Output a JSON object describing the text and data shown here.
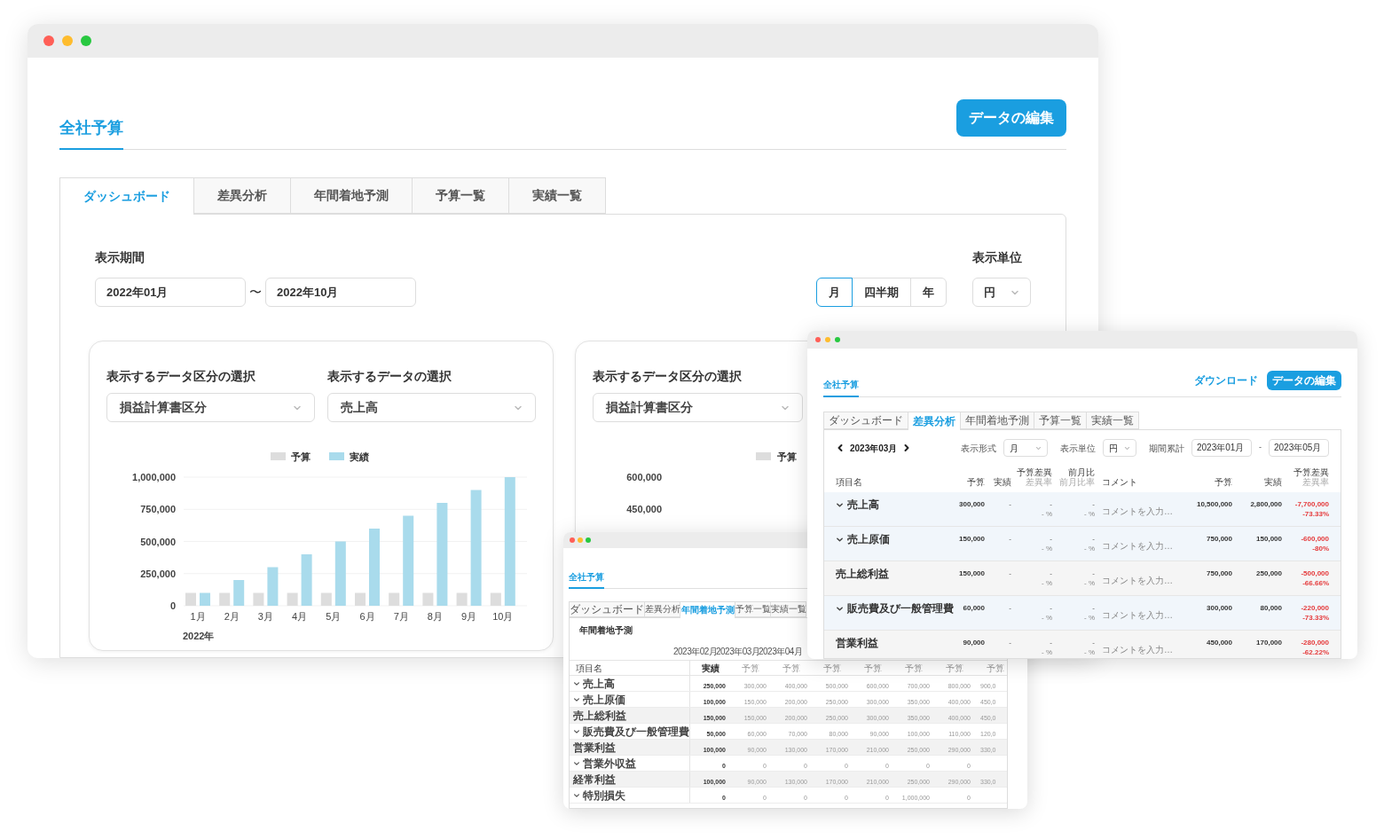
{
  "main_window": {
    "title": "全社予算",
    "edit_button": "データの編集",
    "tabs": [
      {
        "label": "ダッシュボード",
        "selected": true
      },
      {
        "label": "差異分析",
        "selected": false
      },
      {
        "label": "年間着地予測",
        "selected": false
      },
      {
        "label": "予算一覧",
        "selected": false
      },
      {
        "label": "実績一覧",
        "selected": false
      }
    ],
    "period": {
      "label": "表示期間",
      "from": "2022年01月",
      "separator": "〜",
      "to": "2022年10月"
    },
    "granularity": [
      {
        "label": "月",
        "selected": true
      },
      {
        "label": "四半期",
        "selected": false
      },
      {
        "label": "年",
        "selected": false
      }
    ],
    "unit": {
      "label": "表示単位",
      "value": "円"
    },
    "panels": [
      {
        "category_label": "表示するデータ区分の選択",
        "category_value": "損益計算書区分",
        "data_label": "表示するデータの選択",
        "data_value": "売上高",
        "chart_data": {
          "type": "bar",
          "xlabel": "2022年",
          "categories": [
            "1月",
            "2月",
            "3月",
            "4月",
            "5月",
            "6月",
            "7月",
            "8月",
            "9月",
            "10月"
          ],
          "series": [
            {
              "name": "予算",
              "color": "#dddddd",
              "values": [
                100000,
                100000,
                100000,
                100000,
                100000,
                100000,
                100000,
                100000,
                100000,
                100000
              ]
            },
            {
              "name": "実績",
              "color": "#a9dbec",
              "values": [
                100000,
                200000,
                300000,
                400000,
                500000,
                600000,
                700000,
                800000,
                900000,
                1000000
              ]
            }
          ],
          "ylim": [
            0,
            1000000
          ],
          "grid": true,
          "legend": true,
          "yticks": [
            {
              "value": 0,
              "label": "0"
            },
            {
              "value": 250000,
              "label": "250,000"
            },
            {
              "value": 500000,
              "label": "500,000"
            },
            {
              "value": 750000,
              "label": "750,000"
            },
            {
              "value": 1000000,
              "label": "1,000,000"
            }
          ]
        }
      },
      {
        "category_label": "表示するデータ区分の選択",
        "category_value": "損益計算書区分",
        "legend": [
          "予算"
        ],
        "axis_labels": [
          "600,000",
          "450,000"
        ]
      }
    ]
  },
  "variance_window": {
    "title": "全社予算",
    "download_link": "ダウンロード",
    "edit_button": "データの編集",
    "tabs": [
      {
        "label": "ダッシュボード",
        "selected": false
      },
      {
        "label": "差異分析",
        "selected": true
      },
      {
        "label": "年間着地予測",
        "selected": false
      },
      {
        "label": "予算一覧",
        "selected": false
      },
      {
        "label": "実績一覧",
        "selected": false
      }
    ],
    "month": "2023年03月",
    "format": {
      "label": "表示形式",
      "value": "月"
    },
    "unit": {
      "label": "表示単位",
      "value": "円"
    },
    "cumulative": {
      "label": "期間累計",
      "from": "2023年01月",
      "separator": "-",
      "to": "2023年05月"
    },
    "columns": [
      {
        "label": "項目名"
      },
      {
        "label": "予算"
      },
      {
        "label": "実績"
      },
      {
        "label": "予算差異",
        "sublabel": "差異率"
      },
      {
        "label": "前月比",
        "sublabel": "前月比率"
      },
      {
        "label": "コメント"
      },
      {
        "label": "予算"
      },
      {
        "label": "実績"
      },
      {
        "label": "予算差異",
        "sublabel": "差異率"
      }
    ],
    "rows": [
      {
        "name": "売上高",
        "kind": "group",
        "budget": "300,000",
        "actual": "-",
        "variance": "-",
        "variance_rate": "- %",
        "mom": "-",
        "mom_rate": "- %",
        "comment_placeholder": "コメントを入力…",
        "cum_budget": "10,500,000",
        "cum_actual": "2,800,000",
        "cum_variance": "-7,700,000",
        "cum_variance_rate": "-73.33%",
        "negative": true
      },
      {
        "name": "売上原価",
        "kind": "group",
        "budget": "150,000",
        "actual": "-",
        "variance": "-",
        "variance_rate": "- %",
        "mom": "-",
        "mom_rate": "- %",
        "comment_placeholder": "コメントを入力…",
        "cum_budget": "750,000",
        "cum_actual": "150,000",
        "cum_variance": "-600,000",
        "cum_variance_rate": "-80%",
        "negative": true
      },
      {
        "name": "売上総利益",
        "kind": "total",
        "budget": "150,000",
        "actual": "-",
        "variance": "-",
        "variance_rate": "- %",
        "mom": "-",
        "mom_rate": "- %",
        "comment_placeholder": "コメントを入力…",
        "cum_budget": "750,000",
        "cum_actual": "250,000",
        "cum_variance": "-500,000",
        "cum_variance_rate": "-66.66%",
        "negative": true
      },
      {
        "name": "販売費及び一般管理費",
        "kind": "group",
        "budget": "60,000",
        "actual": "-",
        "variance": "-",
        "variance_rate": "- %",
        "mom": "-",
        "mom_rate": "- %",
        "comment_placeholder": "コメントを入力…",
        "cum_budget": "300,000",
        "cum_actual": "80,000",
        "cum_variance": "-220,000",
        "cum_variance_rate": "-73.33%",
        "negative": true
      },
      {
        "name": "営業利益",
        "kind": "total",
        "budget": "90,000",
        "actual": "-",
        "variance": "-",
        "variance_rate": "- %",
        "mom": "-",
        "mom_rate": "- %",
        "comment_placeholder": "コメントを入力…",
        "cum_budget": "450,000",
        "cum_actual": "170,000",
        "cum_variance": "-280,000",
        "cum_variance_rate": "-62.22%",
        "negative": true
      }
    ]
  },
  "forecast_window": {
    "title": "全社予算",
    "tabs": [
      {
        "label": "ダッシュボード",
        "selected": false
      },
      {
        "label": "差異分析",
        "selected": false
      },
      {
        "label": "年間着地予測",
        "selected": true
      },
      {
        "label": "予算一覧",
        "selected": false
      },
      {
        "label": "実績一覧",
        "selected": false
      }
    ],
    "heading": "年間着地予測",
    "months": [
      "2023年02月",
      "2023年03月",
      "2023年04月"
    ],
    "columns": [
      "項目名",
      "実績",
      "予算",
      "予算",
      "予算",
      "予算",
      "予算",
      "予算",
      "予算"
    ],
    "rows": [
      {
        "name": "売上高",
        "kind": "group",
        "values": [
          "250,000",
          "300,000",
          "400,000",
          "500,000",
          "600,000",
          "700,000",
          "800,000",
          "900,0"
        ]
      },
      {
        "name": "売上原価",
        "kind": "group",
        "values": [
          "100,000",
          "150,000",
          "200,000",
          "250,000",
          "300,000",
          "350,000",
          "400,000",
          "450,0"
        ]
      },
      {
        "name": "売上総利益",
        "kind": "total",
        "values": [
          "150,000",
          "150,000",
          "200,000",
          "250,000",
          "300,000",
          "350,000",
          "400,000",
          "450,0"
        ]
      },
      {
        "name": "販売費及び一般管理費",
        "kind": "group",
        "values": [
          "50,000",
          "60,000",
          "70,000",
          "80,000",
          "90,000",
          "100,000",
          "110,000",
          "120,0"
        ]
      },
      {
        "name": "営業利益",
        "kind": "total",
        "values": [
          "100,000",
          "90,000",
          "130,000",
          "170,000",
          "210,000",
          "250,000",
          "290,000",
          "330,0"
        ]
      },
      {
        "name": "営業外収益",
        "kind": "group",
        "values": [
          "0",
          "0",
          "0",
          "0",
          "0",
          "0",
          "0"
        ]
      },
      {
        "name": "経常利益",
        "kind": "total",
        "values": [
          "100,000",
          "90,000",
          "130,000",
          "170,000",
          "210,000",
          "250,000",
          "290,000",
          "330,0"
        ]
      },
      {
        "name": "特別損失",
        "kind": "group",
        "values": [
          "0",
          "0",
          "0",
          "0",
          "0",
          "1,000,000",
          "0"
        ]
      }
    ]
  }
}
